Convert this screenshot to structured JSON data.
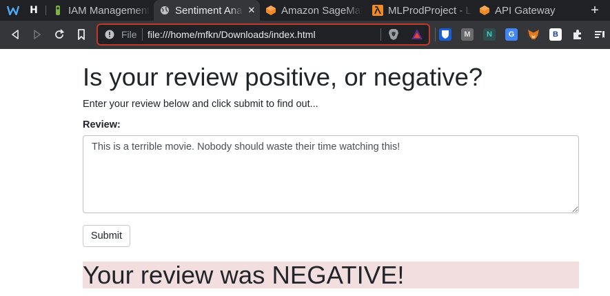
{
  "browser": {
    "tabs": [
      {
        "title": "IAM Management Console",
        "icon": "aws-iam-icon",
        "active": false
      },
      {
        "title": "Sentiment Analysis Web App",
        "icon": "globe-icon",
        "active": true
      },
      {
        "title": "Amazon SageMaker",
        "icon": "aws-box-icon",
        "active": false
      },
      {
        "title": "MLProdProject - Lambda",
        "icon": "lambda-icon",
        "active": false
      },
      {
        "title": "API Gateway",
        "icon": "aws-box-icon",
        "active": false
      }
    ],
    "close_glyph": "✕",
    "new_tab_glyph": "+",
    "omnibox": {
      "scheme_label": "File",
      "url": "file:///home/mfkn/Downloads/index.html"
    },
    "extensions": [
      {
        "name": "bitwarden-icon",
        "glyph": "",
        "color": "#175ddc"
      },
      {
        "name": "mailvelope-icon",
        "glyph": "M",
        "color": "#7a7a7a"
      },
      {
        "name": "notion-icon",
        "glyph": "N",
        "color": "#2f4f4f"
      },
      {
        "name": "google-translate-icon",
        "glyph": "G",
        "color": "#4285f4"
      },
      {
        "name": "metamask-icon",
        "glyph": "",
        "color": "#e2761b"
      },
      {
        "name": "b-extension-icon",
        "glyph": "B",
        "color": "#ffffff"
      }
    ]
  },
  "page": {
    "heading": "Is your review positive, or negative?",
    "instructions": "Enter your review below and click submit to find out...",
    "review_label": "Review:",
    "review_value": "This is a terrible movie. Nobody should waste their time watching this!",
    "submit_label": "Submit",
    "result_text": "Your review was NEGATIVE!",
    "result_color": "#f2dede"
  }
}
